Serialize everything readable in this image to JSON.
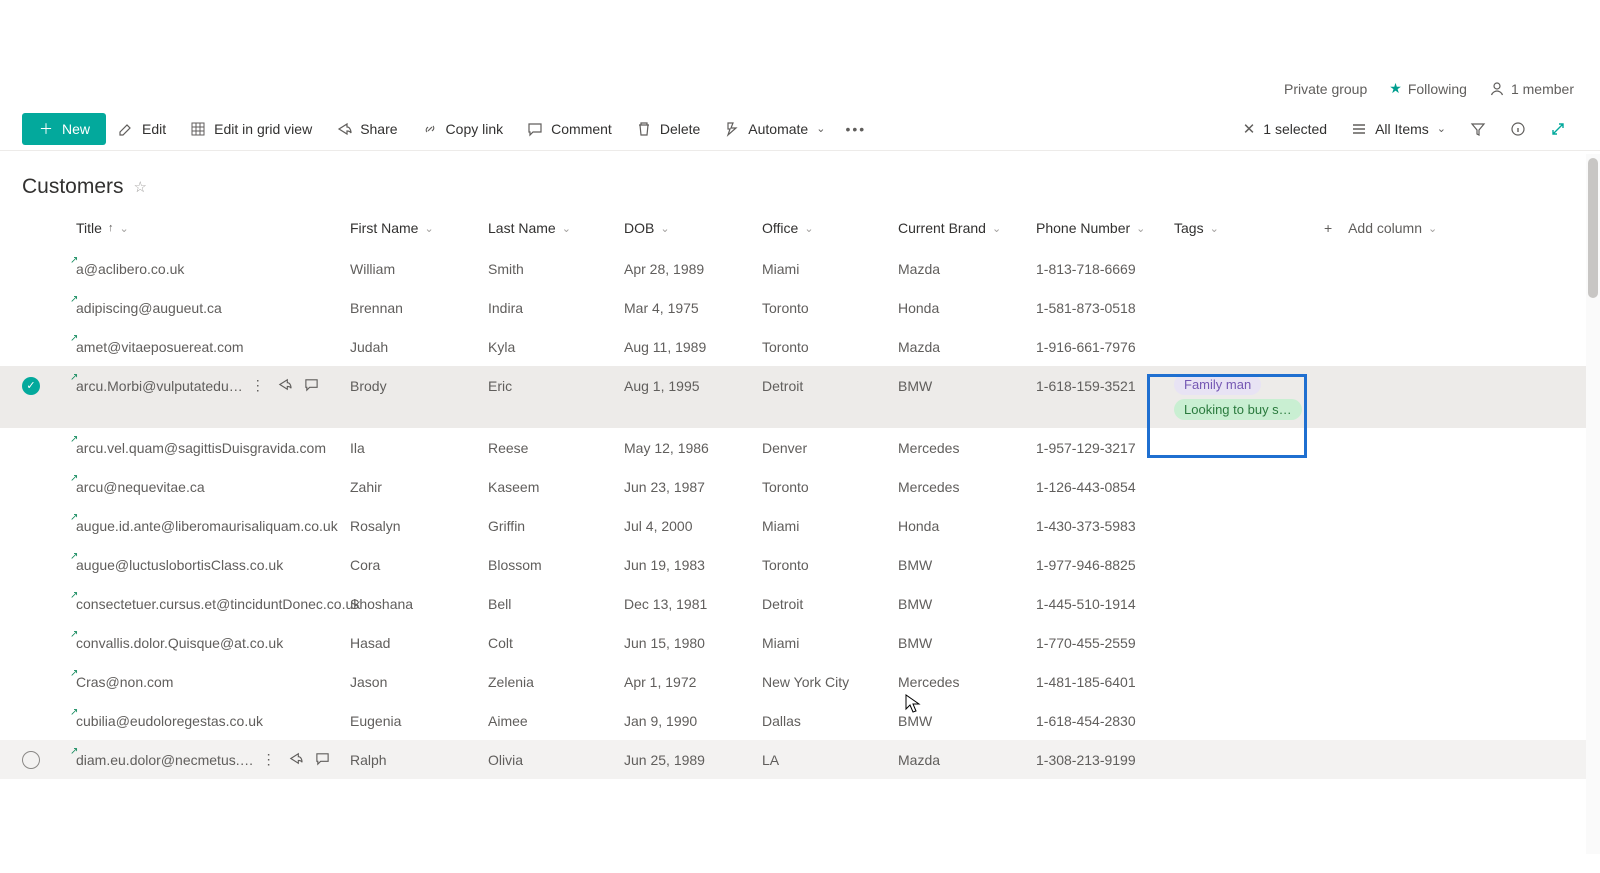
{
  "meta": {
    "privacy": "Private group",
    "following": "Following",
    "members": "1 member"
  },
  "commandBar": {
    "new": "New",
    "edit": "Edit",
    "gridEdit": "Edit in grid view",
    "share": "Share",
    "copyLink": "Copy link",
    "comment": "Comment",
    "delete": "Delete",
    "automate": "Automate",
    "selected": "1 selected",
    "allItems": "All Items"
  },
  "list": {
    "title": "Customers"
  },
  "columns": {
    "title": "Title",
    "first": "First Name",
    "last": "Last Name",
    "dob": "DOB",
    "office": "Office",
    "brand": "Current Brand",
    "phone": "Phone Number",
    "tags": "Tags",
    "add": "Add column"
  },
  "rows": [
    {
      "title": "a@aclibero.co.uk",
      "first": "William",
      "last": "Smith",
      "dob": "Apr 28, 1989",
      "office": "Miami",
      "brand": "Mazda",
      "phone": "1-813-718-6669",
      "selected": false,
      "hover": false,
      "tags": []
    },
    {
      "title": "adipiscing@augueut.ca",
      "first": "Brennan",
      "last": "Indira",
      "dob": "Mar 4, 1975",
      "office": "Toronto",
      "brand": "Honda",
      "phone": "1-581-873-0518",
      "selected": false,
      "hover": false,
      "tags": []
    },
    {
      "title": "amet@vitaeposuereat.com",
      "first": "Judah",
      "last": "Kyla",
      "dob": "Aug 11, 1989",
      "office": "Toronto",
      "brand": "Mazda",
      "phone": "1-916-661-7976",
      "selected": false,
      "hover": false,
      "tags": []
    },
    {
      "title": "arcu.Morbi@vulputatedu…",
      "first": "Brody",
      "last": "Eric",
      "dob": "Aug 1, 1995",
      "office": "Detroit",
      "brand": "BMW",
      "phone": "1-618-159-3521",
      "selected": true,
      "hover": false,
      "tags": [
        {
          "text": "Family man",
          "cls": "purple"
        },
        {
          "text": "Looking to buy s…",
          "cls": "green"
        }
      ]
    },
    {
      "title": "arcu.vel.quam@sagittisDuisgravida.com",
      "first": "Ila",
      "last": "Reese",
      "dob": "May 12, 1986",
      "office": "Denver",
      "brand": "Mercedes",
      "phone": "1-957-129-3217",
      "selected": false,
      "hover": false,
      "tags": []
    },
    {
      "title": "arcu@nequevitae.ca",
      "first": "Zahir",
      "last": "Kaseem",
      "dob": "Jun 23, 1987",
      "office": "Toronto",
      "brand": "Mercedes",
      "phone": "1-126-443-0854",
      "selected": false,
      "hover": false,
      "tags": []
    },
    {
      "title": "augue.id.ante@liberomaurisaliquam.co.uk",
      "first": "Rosalyn",
      "last": "Griffin",
      "dob": "Jul 4, 2000",
      "office": "Miami",
      "brand": "Honda",
      "phone": "1-430-373-5983",
      "selected": false,
      "hover": false,
      "tags": []
    },
    {
      "title": "augue@luctuslobortisClass.co.uk",
      "first": "Cora",
      "last": "Blossom",
      "dob": "Jun 19, 1983",
      "office": "Toronto",
      "brand": "BMW",
      "phone": "1-977-946-8825",
      "selected": false,
      "hover": false,
      "tags": []
    },
    {
      "title": "consectetuer.cursus.et@tinciduntDonec.co.uk",
      "first": "Shoshana",
      "last": "Bell",
      "dob": "Dec 13, 1981",
      "office": "Detroit",
      "brand": "BMW",
      "phone": "1-445-510-1914",
      "selected": false,
      "hover": false,
      "tags": []
    },
    {
      "title": "convallis.dolor.Quisque@at.co.uk",
      "first": "Hasad",
      "last": "Colt",
      "dob": "Jun 15, 1980",
      "office": "Miami",
      "brand": "BMW",
      "phone": "1-770-455-2559",
      "selected": false,
      "hover": false,
      "tags": []
    },
    {
      "title": "Cras@non.com",
      "first": "Jason",
      "last": "Zelenia",
      "dob": "Apr 1, 1972",
      "office": "New York City",
      "brand": "Mercedes",
      "phone": "1-481-185-6401",
      "selected": false,
      "hover": false,
      "tags": []
    },
    {
      "title": "cubilia@eudoloregestas.co.uk",
      "first": "Eugenia",
      "last": "Aimee",
      "dob": "Jan 9, 1990",
      "office": "Dallas",
      "brand": "BMW",
      "phone": "1-618-454-2830",
      "selected": false,
      "hover": false,
      "tags": []
    },
    {
      "title": "diam.eu.dolor@necmetus.…",
      "first": "Ralph",
      "last": "Olivia",
      "dob": "Jun 25, 1989",
      "office": "LA",
      "brand": "Mazda",
      "phone": "1-308-213-9199",
      "selected": false,
      "hover": true,
      "tags": []
    }
  ]
}
